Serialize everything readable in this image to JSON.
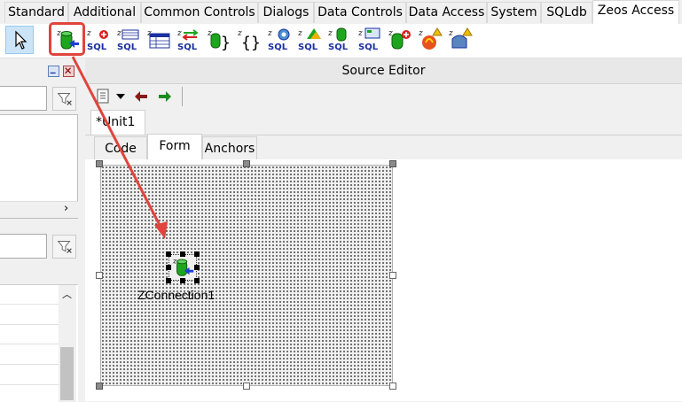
{
  "palette_tabs": [
    {
      "label": "Standard"
    },
    {
      "label": "Additional"
    },
    {
      "label": "Common Controls"
    },
    {
      "label": "Dialogs"
    },
    {
      "label": "Data Controls"
    },
    {
      "label": "Data Access"
    },
    {
      "label": "System"
    },
    {
      "label": "SQLdb"
    },
    {
      "label": "Zeos Access",
      "active": true
    }
  ],
  "palette_icons": [
    "selection-pointer-icon",
    "zconnection-icon",
    "zquery-icon",
    "zreadonlyquery-icon",
    "ztable-icon",
    "zupdatesql-icon",
    "zstoredproc-icon",
    "zsqlprocessor-icon",
    "zsqlmonitor-icon",
    "zsqlmetadata-icon",
    "zsequence-icon",
    "zconnectiongroup-icon",
    "zgroupedconnection-icon",
    "zirconnection-icon",
    "zirhelper-icon"
  ],
  "source_editor": {
    "title": "Source Editor",
    "unit_tab": "*Unit1",
    "view_tabs": [
      "Code",
      "Form",
      "Anchors"
    ],
    "active_view": "Form"
  },
  "form": {
    "component_label": "ZConnection1"
  },
  "colors": {
    "highlight": "#e0443c",
    "arrow": "#e0443c",
    "selection_blue": "#cce4f7"
  }
}
